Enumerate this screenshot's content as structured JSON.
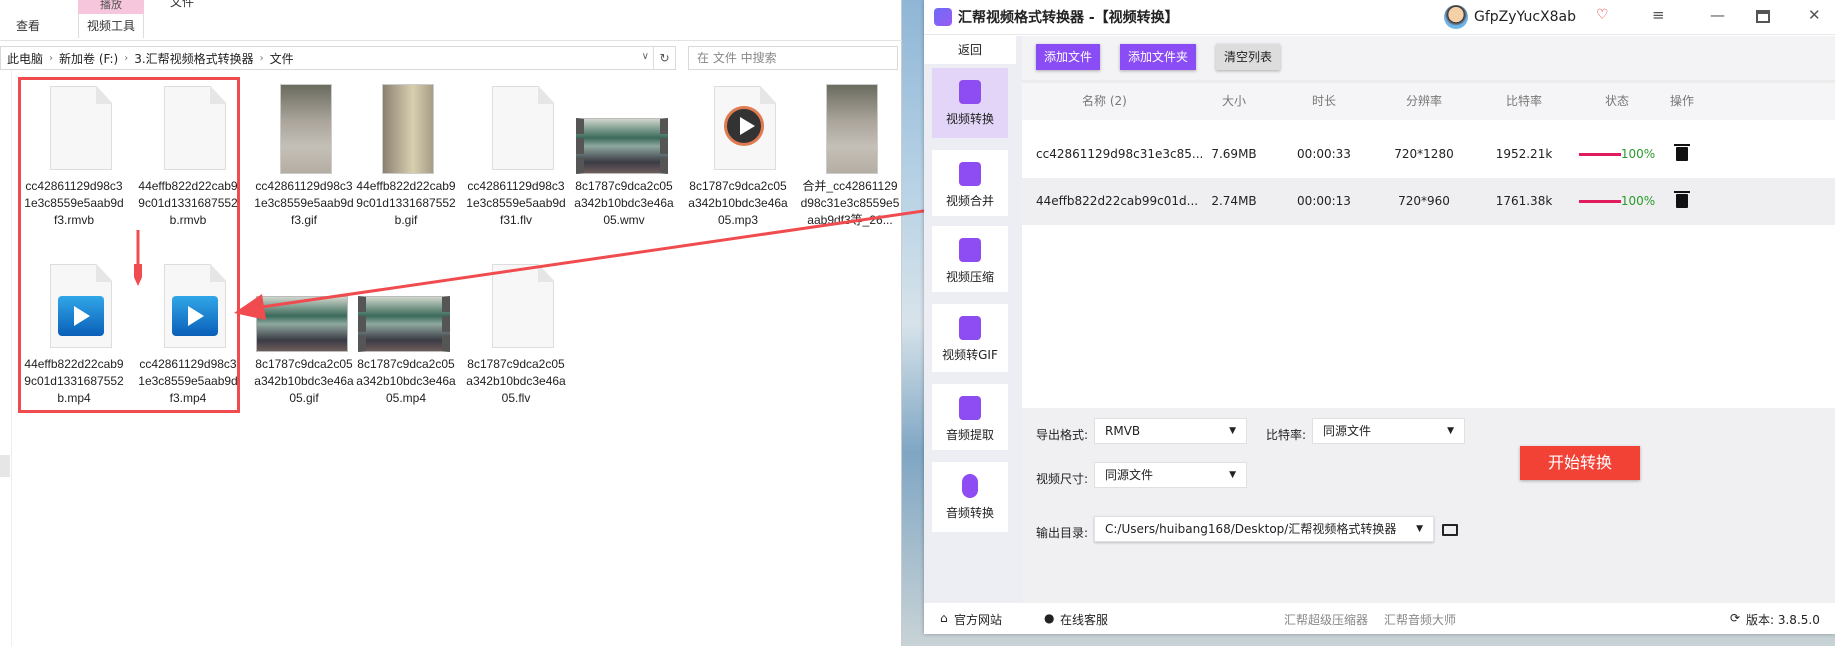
{
  "explorer": {
    "ribbon": {
      "play_tab": "播放",
      "file_tab": "文件",
      "view_tab": "查看",
      "video_tools_tab": "视频工具"
    },
    "breadcrumb": [
      "此电脑",
      "新加卷 (F:)",
      "3.汇帮视频格式转换器",
      "文件"
    ],
    "search_placeholder": "在 文件 中搜索",
    "files": [
      {
        "name": "cc42861129d98c31e3c8559e5aab9df3.rmvb",
        "type": "doc"
      },
      {
        "name": "44effb822d22cab99c01d1331687552b.rmvb",
        "type": "doc"
      },
      {
        "name": "cc42861129d98c31e3c8559e5aab9df3.gif",
        "type": "thumb"
      },
      {
        "name": "44effb822d22cab99c01d1331687552b.gif",
        "type": "thumb-blur"
      },
      {
        "name": "cc42861129d98c31e3c8559e5aab9df31.flv",
        "type": "doc"
      },
      {
        "name": "8c1787c9dca2c05a342b10bdc3e46a05.wmv",
        "type": "film"
      },
      {
        "name": "8c1787c9dca2c05a342b10bdc3e46a05.mp3",
        "type": "mp3"
      },
      {
        "name": "合并_cc42861129d98c31e3c8559e5aab9df3等_26...",
        "type": "thumb"
      },
      {
        "name": "44effb822d22cab99c01d1331687552b.mp4",
        "type": "mp4"
      },
      {
        "name": "cc42861129d98c31e3c8559e5aab9df3.mp4",
        "type": "mp4"
      },
      {
        "name": "8c1787c9dca2c05a342b10bdc3e46a05.gif",
        "type": "wide"
      },
      {
        "name": "8c1787c9dca2c05a342b10bdc3e46a05.mp4",
        "type": "film"
      },
      {
        "name": "8c1787c9dca2c05a342b10bdc3e46a05.flv",
        "type": "doc"
      }
    ]
  },
  "app": {
    "title": "汇帮视频格式转换器  -【视频转换】",
    "username": "GfpZyYucX8ab",
    "sidebar": {
      "back": "返回",
      "items": [
        "视频转换",
        "视频合并",
        "视频压缩",
        "视频转GIF",
        "音频提取",
        "音频转换"
      ]
    },
    "toolbar": {
      "add_file": "添加文件",
      "add_folder": "添加文件夹",
      "clear_list": "清空列表"
    },
    "table": {
      "headers": [
        "名称 (2)",
        "大小",
        "时长",
        "分辨率",
        "比特率",
        "状态",
        "操作"
      ],
      "rows": [
        {
          "name": "cc42861129d98c31e3c85...",
          "size": "7.69MB",
          "duration": "00:00:33",
          "resolution": "720*1280",
          "bitrate": "1952.21k",
          "progress": "100%"
        },
        {
          "name": "44effb822d22cab99c01d...",
          "size": "2.74MB",
          "duration": "00:00:13",
          "resolution": "720*960",
          "bitrate": "1761.38k",
          "progress": "100%"
        }
      ]
    },
    "settings": {
      "format_label": "导出格式:",
      "format_value": "RMVB",
      "bitrate_label": "比特率:",
      "bitrate_value": "同源文件",
      "size_label": "视频尺寸:",
      "size_value": "同源文件",
      "output_label": "输出目录:",
      "output_value": "C:/Users/huibang168/Desktop/汇帮视频格式转换器",
      "start": "开始转换"
    },
    "footer": {
      "website": "官方网站",
      "support": "在线客服",
      "link1": "汇帮超级压缩器",
      "link2": "汇帮音频大师",
      "version": "版本: 3.8.5.0"
    },
    "colors": {
      "accent": "#8a4df5",
      "start": "#f24235",
      "progress": "#e21b5c"
    }
  }
}
